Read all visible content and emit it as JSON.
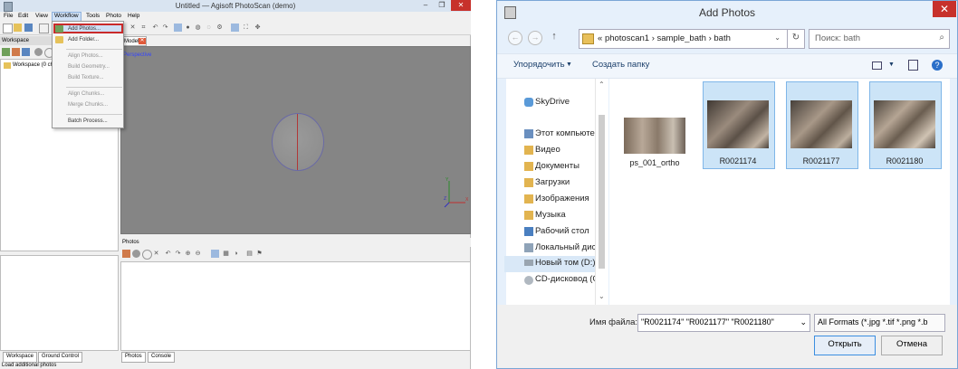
{
  "photoscan": {
    "title": "Untitled — Agisoft PhotoScan (demo)",
    "window_controls": {
      "min": "–",
      "max": "❐",
      "close": "✕"
    },
    "menu": [
      "File",
      "Edit",
      "View",
      "Workflow",
      "Tools",
      "Photo",
      "Help"
    ],
    "workspace_header": "Workspace",
    "workspace_tree_item": "Workspace (0 ch",
    "model_tab": "Model",
    "model_close": "✕",
    "viewport_label": "Perspective",
    "axis": {
      "y": "Y",
      "x": "X",
      "z": "Z"
    },
    "photos_header": "Photos",
    "bottom_tabs_left": [
      "Workspace",
      "Ground Control"
    ],
    "bottom_tabs_right": [
      "Photos",
      "Console"
    ],
    "status": "Load additional photos",
    "workflow_menu": {
      "items": [
        {
          "label": "Add Photos...",
          "enabled": true,
          "highlighted": true
        },
        {
          "label": "Add Folder...",
          "enabled": true
        },
        {
          "label": "Align Photos...",
          "enabled": false
        },
        {
          "label": "Build Geometry...",
          "enabled": false
        },
        {
          "label": "Build Texture...",
          "enabled": false
        },
        {
          "label": "Align Chunks...",
          "enabled": false
        },
        {
          "label": "Merge Chunks...",
          "enabled": false
        },
        {
          "label": "Batch Process...",
          "enabled": true
        }
      ]
    },
    "colors": {
      "highlight_border": "#c92a2a",
      "viewport": "#858585"
    }
  },
  "dialog": {
    "title": "Add Photos",
    "close": "✕",
    "nav": {
      "back": "←",
      "forward": "→",
      "up": "↑"
    },
    "address": {
      "prefix": "«",
      "parts": [
        "photoscan1",
        "sample_bath",
        "bath"
      ],
      "separator": "›"
    },
    "search_placeholder": "Поиск: bath",
    "search_icon": "⌕",
    "commands": {
      "organize": "Упорядочить",
      "new_folder": "Создать папку"
    },
    "nav_pane": [
      {
        "label": "SkyDrive",
        "icon": "cloud-icon"
      },
      {
        "label": "Этот компьютер",
        "icon": "computer-icon"
      },
      {
        "label": "Видео",
        "icon": "video-folder-icon"
      },
      {
        "label": "Документы",
        "icon": "documents-folder-icon"
      },
      {
        "label": "Загрузки",
        "icon": "downloads-folder-icon"
      },
      {
        "label": "Изображения",
        "icon": "pictures-folder-icon"
      },
      {
        "label": "Музыка",
        "icon": "music-folder-icon"
      },
      {
        "label": "Рабочий стол",
        "icon": "desktop-folder-icon"
      },
      {
        "label": "Локальный диск",
        "icon": "local-disk-icon"
      },
      {
        "label": "Новый том (D:)",
        "icon": "drive-icon",
        "selected": true
      },
      {
        "label": "CD-дисковод (G:",
        "icon": "cd-drive-icon"
      }
    ],
    "files": [
      {
        "name": "ps_001_ortho",
        "selected": false
      },
      {
        "name": "R0021174",
        "selected": true
      },
      {
        "name": "R0021177",
        "selected": true
      },
      {
        "name": "R0021180",
        "selected": true
      }
    ],
    "filename_label": "Имя файла:",
    "filename_value": "\"R0021174\" \"R0021177\" \"R0021180\"",
    "filter": "All Formats (*.jpg *.tif *.png *.b",
    "open": "Открыть",
    "cancel": "Отмена",
    "colors": {
      "selection_bg": "#cce4f7",
      "selection_border": "#7fb6e8",
      "accent": "#3b8ee0"
    }
  }
}
